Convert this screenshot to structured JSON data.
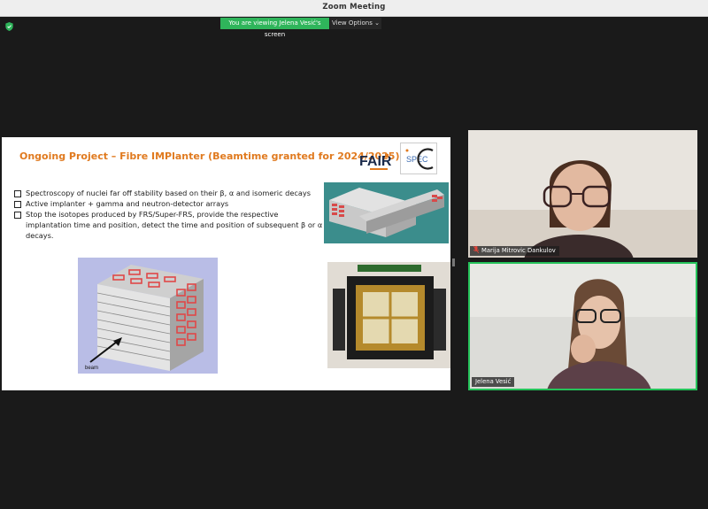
{
  "window": {
    "title": "Zoom Meeting"
  },
  "share": {
    "banner": "You are viewing Jelena Vesić's screen",
    "view_options": "View Options ⌄"
  },
  "slide": {
    "title": "Ongoing Project – Fibre IMPlanter (Beamtime granted for 2024/2025)",
    "bullets": [
      "Spectroscopy of nuclei far off stability based on their β, α and isomeric decays",
      "Active implanter + gamma  and neutron-detector arrays",
      "Stop the isotopes produced by FRS/Super-FRS, provide the respective implantation time and position, detect the time and position of subsequent β or α decays."
    ],
    "logo_fair": "FAIR",
    "logo_spec": "SPEC",
    "cube_label": "beam"
  },
  "participants": [
    {
      "name": "Marija Mitrovic Dankulov",
      "muted": true
    },
    {
      "name": "Jelena Vesić",
      "active_speaker": true
    }
  ],
  "colors": {
    "accent_green": "#2fb55b",
    "slide_title": "#e07a1f",
    "muted_red": "#e0453a"
  }
}
